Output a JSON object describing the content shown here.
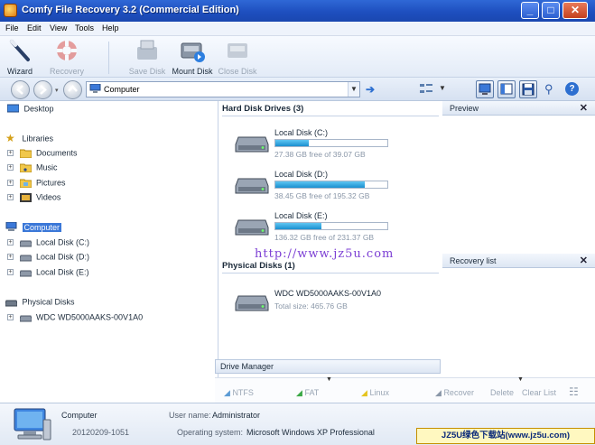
{
  "window": {
    "title": "Comfy File Recovery 3.2 (Commercial Edition)",
    "min_label": "_",
    "max_label": "□",
    "close_label": "✕"
  },
  "menu": [
    "File",
    "Edit",
    "View",
    "Tools",
    "Help"
  ],
  "toolbar": {
    "wizard": "Wizard",
    "recovery": "Recovery",
    "save_disk": "Save Disk",
    "mount_disk": "Mount Disk",
    "close_disk": "Close Disk"
  },
  "address": {
    "value": "Computer"
  },
  "tree": {
    "desktop": "Desktop",
    "libraries": "Libraries",
    "documents": "Documents",
    "music": "Music",
    "pictures": "Pictures",
    "videos": "Videos",
    "computer": "Computer",
    "disk_c": "Local Disk (C:)",
    "disk_d": "Local Disk (D:)",
    "disk_e": "Local Disk (E:)",
    "physical_disks": "Physical Disks",
    "wdc": "WDC WD5000AAKS-00V1A0"
  },
  "center": {
    "hdd_header": "Hard Disk Drives (3)",
    "phys_header": "Physical Disks (1)",
    "disks": [
      {
        "name": "Local Disk (C:)",
        "free": "27.38 GB free of 39.07 GB",
        "used_fraction": 0.3
      },
      {
        "name": "Local Disk (D:)",
        "free": "38.45 GB free of 195.32 GB",
        "used_fraction": 0.8
      },
      {
        "name": "Local Disk (E:)",
        "free": "136.32 GB free of 231.37 GB",
        "used_fraction": 0.41
      }
    ],
    "physical": {
      "name": "WDC WD5000AAKS-00V1A0",
      "size": "Total size: 465.76 GB"
    },
    "watermark": "http://www.jz5u.com"
  },
  "panels": {
    "preview": "Preview",
    "recovery_list": "Recovery list",
    "close": "✕"
  },
  "drive_manager": {
    "title": "Drive Manager",
    "ntfs": "NTFS",
    "fat": "FAT",
    "linux": "Linux",
    "recover": "Recover",
    "delete": "Delete",
    "clear_list": "Clear List"
  },
  "status": {
    "name": "Computer",
    "build": "20120209-1051",
    "user_label": "User name:",
    "user_value": "Administrator",
    "os_label": "Operating system:",
    "os_value": "Microsoft Windows XP Professional"
  },
  "badge": "JZ5U绿色下载站(www.jz5u.com)"
}
